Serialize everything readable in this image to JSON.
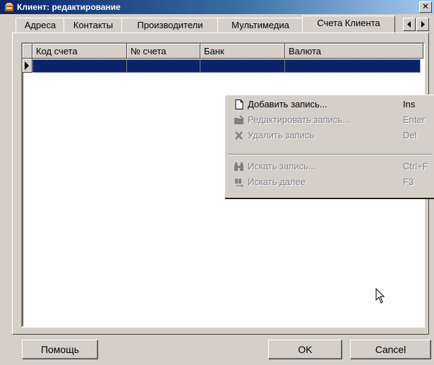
{
  "window": {
    "title": "Клиент: редактирование",
    "close_glyph": "✕"
  },
  "tabs": [
    {
      "label": "Адреса"
    },
    {
      "label": "Контакты"
    },
    {
      "label": "Производители"
    },
    {
      "label": "Мультимедиа"
    },
    {
      "label": "Счета Клиента",
      "active": true
    }
  ],
  "tab_scroll": {
    "left_icon": "arrow-left-icon",
    "right_icon": "arrow-right-icon"
  },
  "grid": {
    "columns": [
      "Код счета",
      "№ счета",
      "Банк",
      "Валюта"
    ],
    "selected_row_indicator": "row-pointer-icon"
  },
  "context_menu": {
    "items": [
      {
        "label": "Добавить запись...",
        "shortcut": "Ins",
        "icon": "new-document-icon",
        "enabled": true
      },
      {
        "label": "Редактировать запись...",
        "shortcut": "Enter",
        "icon": "edit-folder-icon",
        "enabled": false
      },
      {
        "label": "Удалить запись",
        "shortcut": "Del",
        "icon": "delete-x-icon",
        "enabled": false
      },
      {
        "label": "Искать запись...",
        "shortcut": "Ctrl+F",
        "icon": "binoculars-icon",
        "enabled": false
      },
      {
        "label": "Искать далее",
        "shortcut": "F3",
        "icon": "find-next-icon",
        "enabled": false
      }
    ]
  },
  "buttons": {
    "help": "Помощь",
    "ok": "OK",
    "cancel": "Cancel"
  },
  "colors": {
    "selection": "#0a246a",
    "face": "#d4d0c8",
    "title_start": "#0a246a"
  }
}
